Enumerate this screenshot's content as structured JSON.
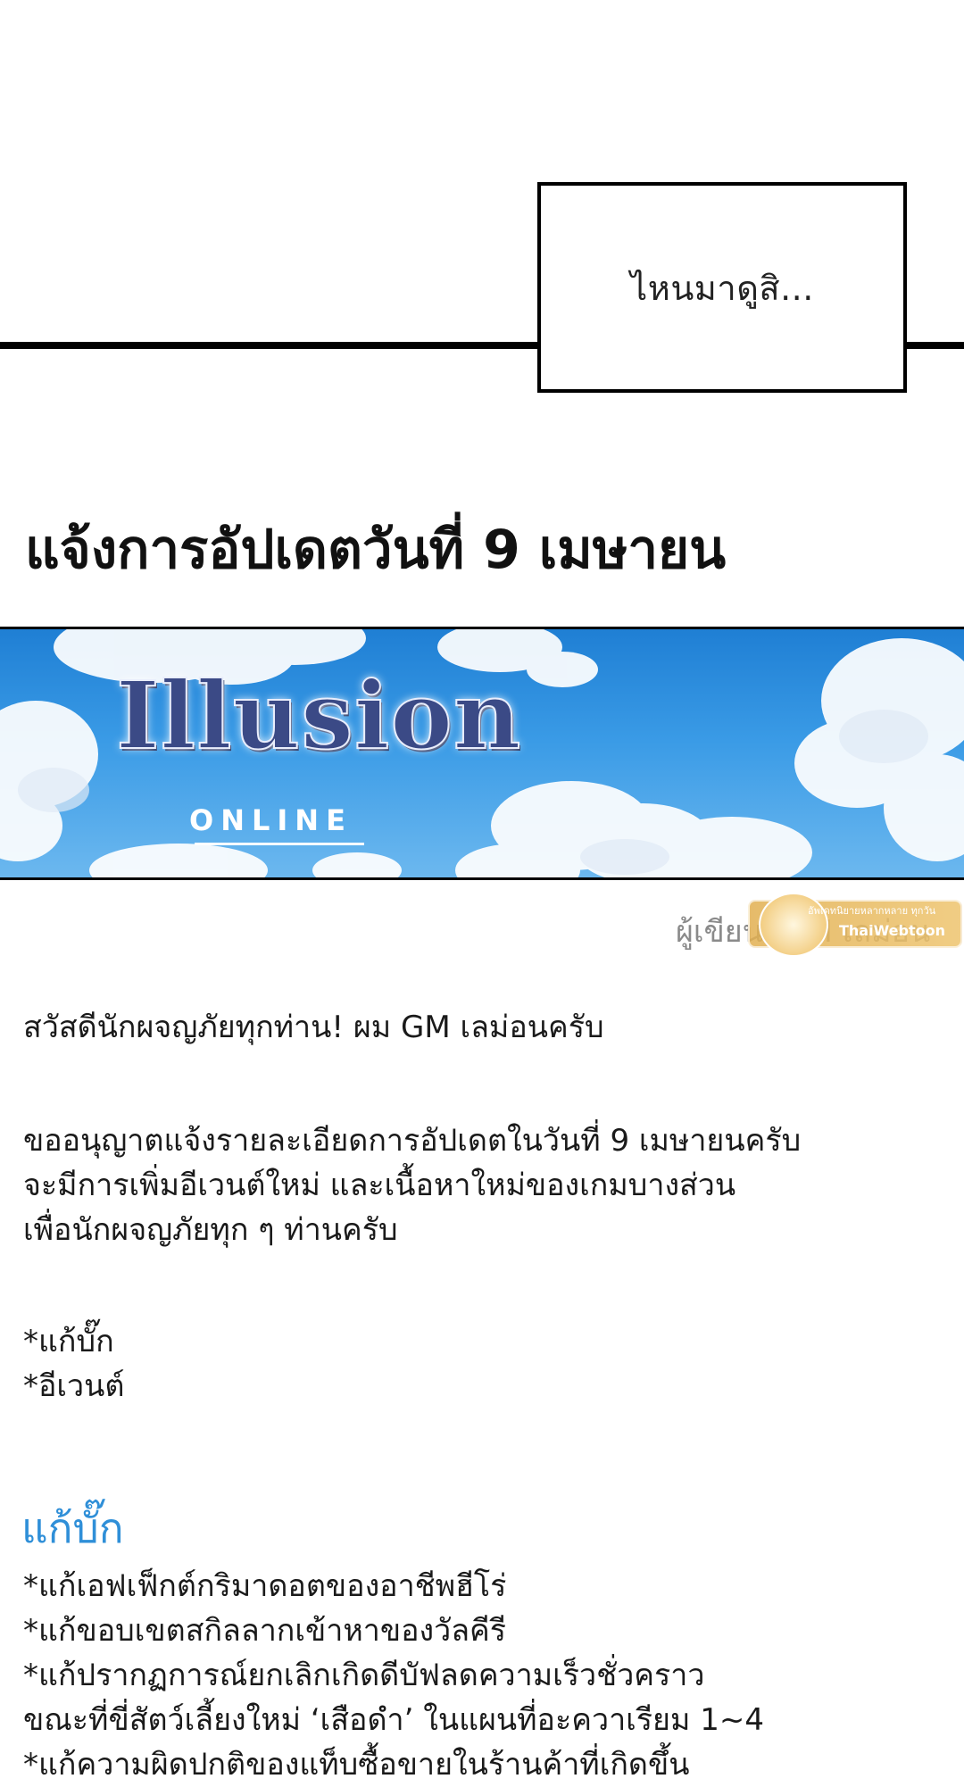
{
  "speech_bubble": {
    "text": "ไหนมาดูสิ..."
  },
  "notice": {
    "title": "แจ้งการอัปเดตวันที่ 9 เมษายน"
  },
  "banner": {
    "logo_title": "Illusion",
    "logo_subtitle": "ONLINE"
  },
  "author": {
    "text": "ผู้เขียน: GM เลม่อน"
  },
  "watermark": {
    "tagline": "อัพเดทนิยายหลากหลาย ทุกวัน",
    "name": "ThaiWebtoon"
  },
  "body": {
    "greeting": "สวัสดีนักผจญภัยทุกท่าน! ผม GM เลม่อนครับ",
    "intro_lines": [
      "ขออนุญาตแจ้งรายละเอียดการอัปเดตในวันที่ 9 เมษายนครับ",
      "จะมีการเพิ่มอีเวนต์ใหม่ และเนื้อหาใหม่ของเกมบางส่วน",
      "เพื่อนักผจญภัยทุก ๆ ท่านครับ"
    ],
    "toc": [
      "*แก้บั๊ก",
      "*อีเวนต์"
    ]
  },
  "bugfix": {
    "heading": "แก้บั๊ก",
    "items": [
      "*แก้เอฟเฟ็กต์กริมาดอตของอาชีพฮีโร่",
      "*แก้ขอบเขตสกิลลากเข้าหาของวัลคีรี",
      "*แก้ปรากฏการณ์ยกเลิกเกิดดีบัฟลดความเร็วชั่วคราว",
      "ขณะที่ขี่สัตว์เลี้ยงใหม่ ‘เสือดำ’ ในแผนที่อะควาเรียม 1~4",
      "*แก้ความผิดปกติของแท็บซื้อขายในร้านค้าที่เกิดขึ้น"
    ]
  }
}
